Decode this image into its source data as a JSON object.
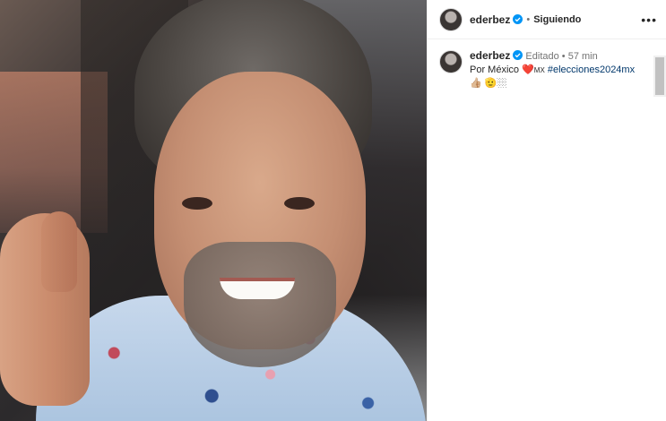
{
  "post": {
    "username": "ederbez",
    "follow_status": "Siguiendo",
    "caption": {
      "edited_label": "Editado",
      "time": "57 min",
      "text_prefix": "Por México",
      "heart": "❤️",
      "flag_text": "MX",
      "hashtag": "#elecciones2024mx",
      "emojis": "👍🏼 🫡🏼"
    }
  },
  "icons": {
    "verified": "verified-badge-icon",
    "more": "more-options-icon"
  },
  "colors": {
    "verified_blue": "#0095f6",
    "hashtag": "#00376b",
    "meta_gray": "#737373"
  }
}
